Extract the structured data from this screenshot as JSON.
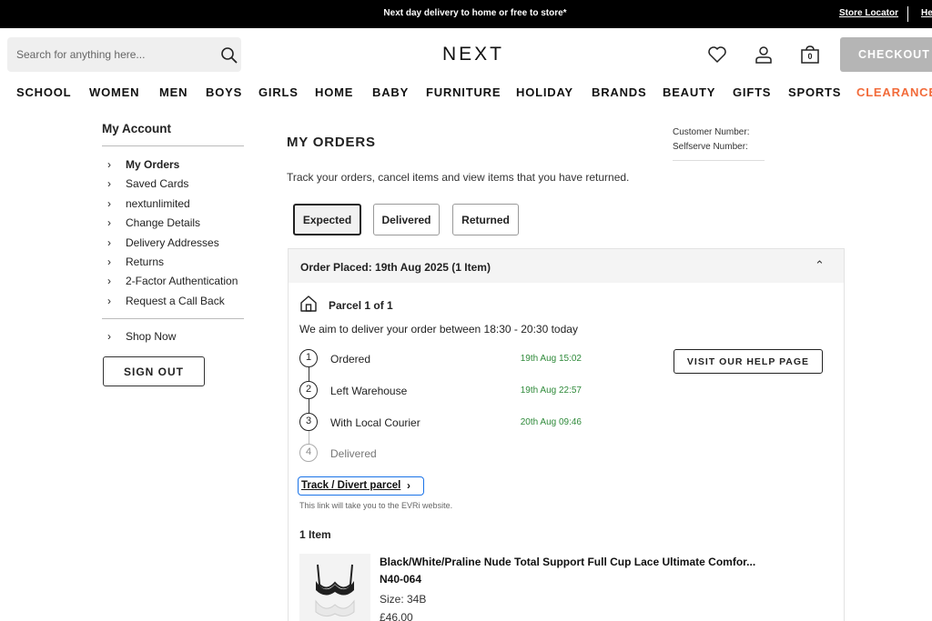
{
  "banner": {
    "promo": "Next day delivery to home or free to store*",
    "store_locator": "Store Locator",
    "help": "Help"
  },
  "header": {
    "search_placeholder": "Search for anything here...",
    "logo": "NEXT",
    "bag_count": "0",
    "checkout_label": "CHECKOUT"
  },
  "nav": {
    "items": [
      "SCHOOL",
      "WOMEN",
      "MEN",
      "BOYS",
      "GIRLS",
      "HOME",
      "BABY",
      "FURNITURE",
      "HOLIDAY",
      "BRANDS",
      "BEAUTY",
      "GIFTS",
      "SPORTS",
      "CLEARANCE"
    ],
    "clearance_color": "#f26b3a"
  },
  "account": {
    "title": "My Account",
    "menu": [
      "My Orders",
      "Saved Cards",
      "nextunlimited",
      "Change Details",
      "Delivery Addresses",
      "Returns",
      "2-Factor Authentication",
      "Request a Call Back"
    ],
    "shop_now": "Shop Now",
    "sign_out": "SIGN OUT"
  },
  "orders": {
    "title": "MY ORDERS",
    "customer_number_label": "Customer Number:",
    "selfserve_number_label": "Selfserve Number:",
    "intro": "Track your orders, cancel items and view items that you have returned.",
    "tabs": [
      "Expected",
      "Delivered",
      "Returned"
    ],
    "active_tab": "Expected",
    "order_placed": "Order Placed: 19th Aug 2025 (1 Item)",
    "parcel_title": "Parcel 1 of 1",
    "delivery_message": "We aim to deliver your order between 18:30 - 20:30 today",
    "steps": [
      {
        "num": "1",
        "label": "Ordered",
        "time": "19th Aug 15:02"
      },
      {
        "num": "2",
        "label": "Left Warehouse",
        "time": "19th Aug 22:57"
      },
      {
        "num": "3",
        "label": "With Local Courier",
        "time": "20th Aug 09:46"
      },
      {
        "num": "4",
        "label": "Delivered",
        "time": ""
      }
    ],
    "help_button": "VISIT OUR HELP PAGE",
    "track_link": "Track / Divert parcel",
    "track_note": "This link will take you to the EVRi website.",
    "items_count": "1 Item",
    "product": {
      "name": "Black/White/Praline Nude Total Support Full Cup Lace Ultimate Comfor...",
      "code": "N40-064",
      "size": "Size: 34B",
      "price": "£46.00"
    },
    "status_color": "#2f8a3a"
  }
}
